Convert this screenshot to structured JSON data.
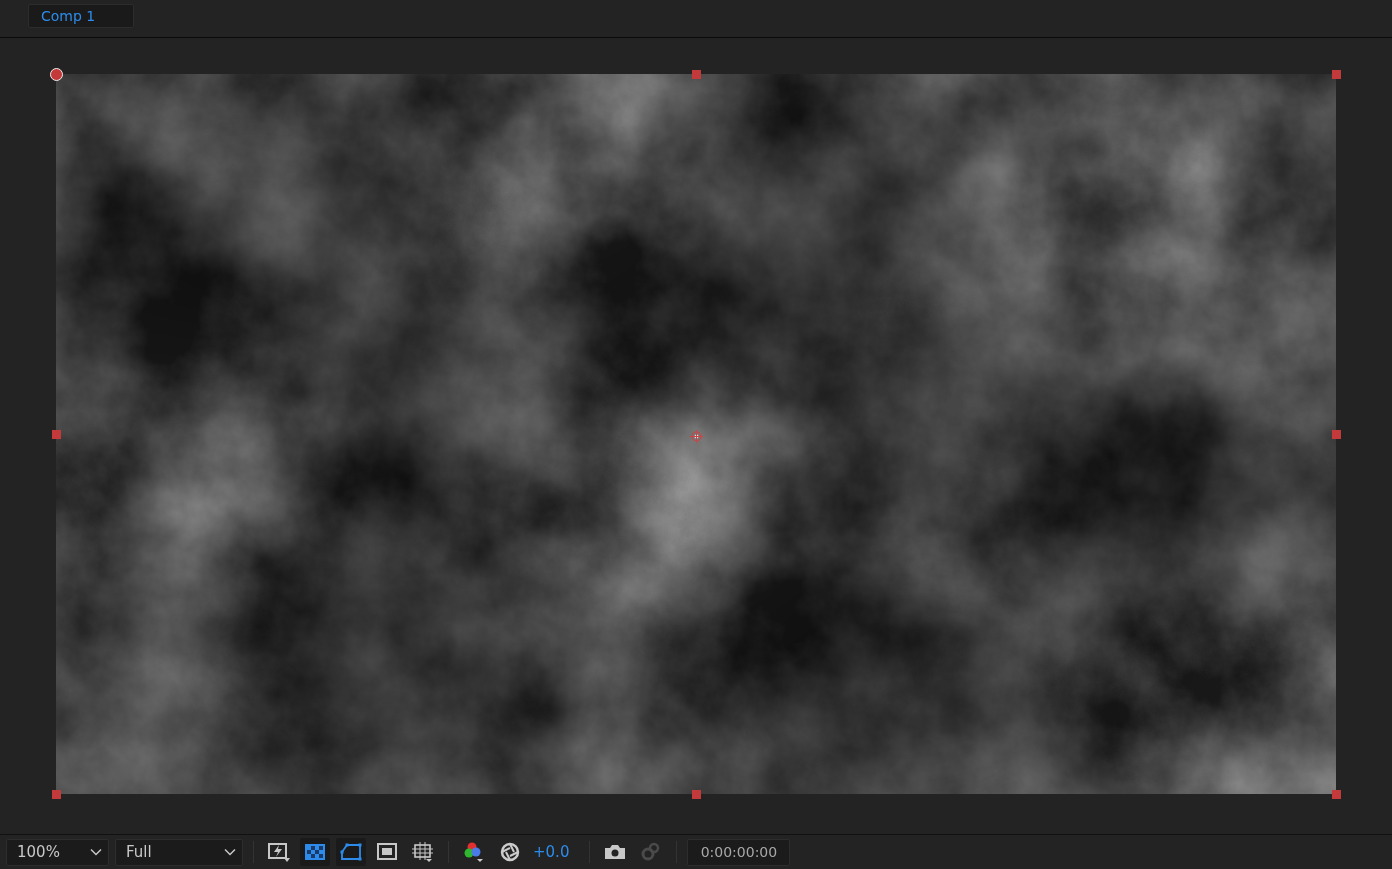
{
  "tab": {
    "label": "Comp 1",
    "selected": true
  },
  "toolbar": {
    "magnification": "100%",
    "resolution": "Full",
    "view_toggles": [
      {
        "kind": "fast-previews",
        "on": false
      },
      {
        "kind": "transparency-grid",
        "on": true
      },
      {
        "kind": "mask-visibility",
        "on": true
      },
      {
        "kind": "region-of-interest",
        "on": false
      },
      {
        "kind": "grid",
        "on": false
      }
    ],
    "channels": {
      "kind": "channels"
    },
    "exposure": "+0.0",
    "snapshot_buttons": [
      {
        "kind": "take-snapshot",
        "disabled": false
      },
      {
        "kind": "show-snapshot",
        "disabled": true
      }
    ],
    "timecode": "0:00:00:00"
  }
}
